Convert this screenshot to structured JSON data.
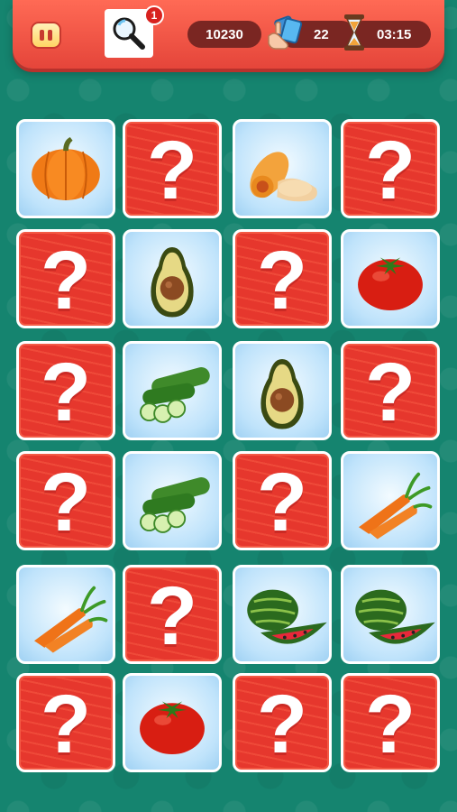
{
  "header": {
    "hint_count": "1",
    "score": "10230",
    "moves": "22",
    "time": "03:15"
  },
  "colors": {
    "header_red": "#e5453a",
    "card_back_red": "#e6372d",
    "board_green": "#15846f",
    "pill_dark": "#7a2622"
  },
  "board": {
    "rows": 6,
    "columns": 4,
    "cards": [
      [
        "pumpkin",
        "hidden",
        "butternut-squash",
        "hidden"
      ],
      [
        "hidden",
        "avocado",
        "hidden",
        "tomato"
      ],
      [
        "hidden",
        "cucumber",
        "avocado",
        "hidden"
      ],
      [
        "hidden",
        "cucumber",
        "hidden",
        "carrot"
      ],
      [
        "carrot",
        "hidden",
        "watermelon",
        "watermelon"
      ],
      [
        "hidden",
        "tomato",
        "hidden",
        "hidden"
      ]
    ]
  },
  "icons": {
    "pause": "pause-icon",
    "hint": "magnifier-icon",
    "moves": "hand-cards-icon",
    "timer": "hourglass-icon",
    "hidden_card": "question-mark-icon"
  }
}
